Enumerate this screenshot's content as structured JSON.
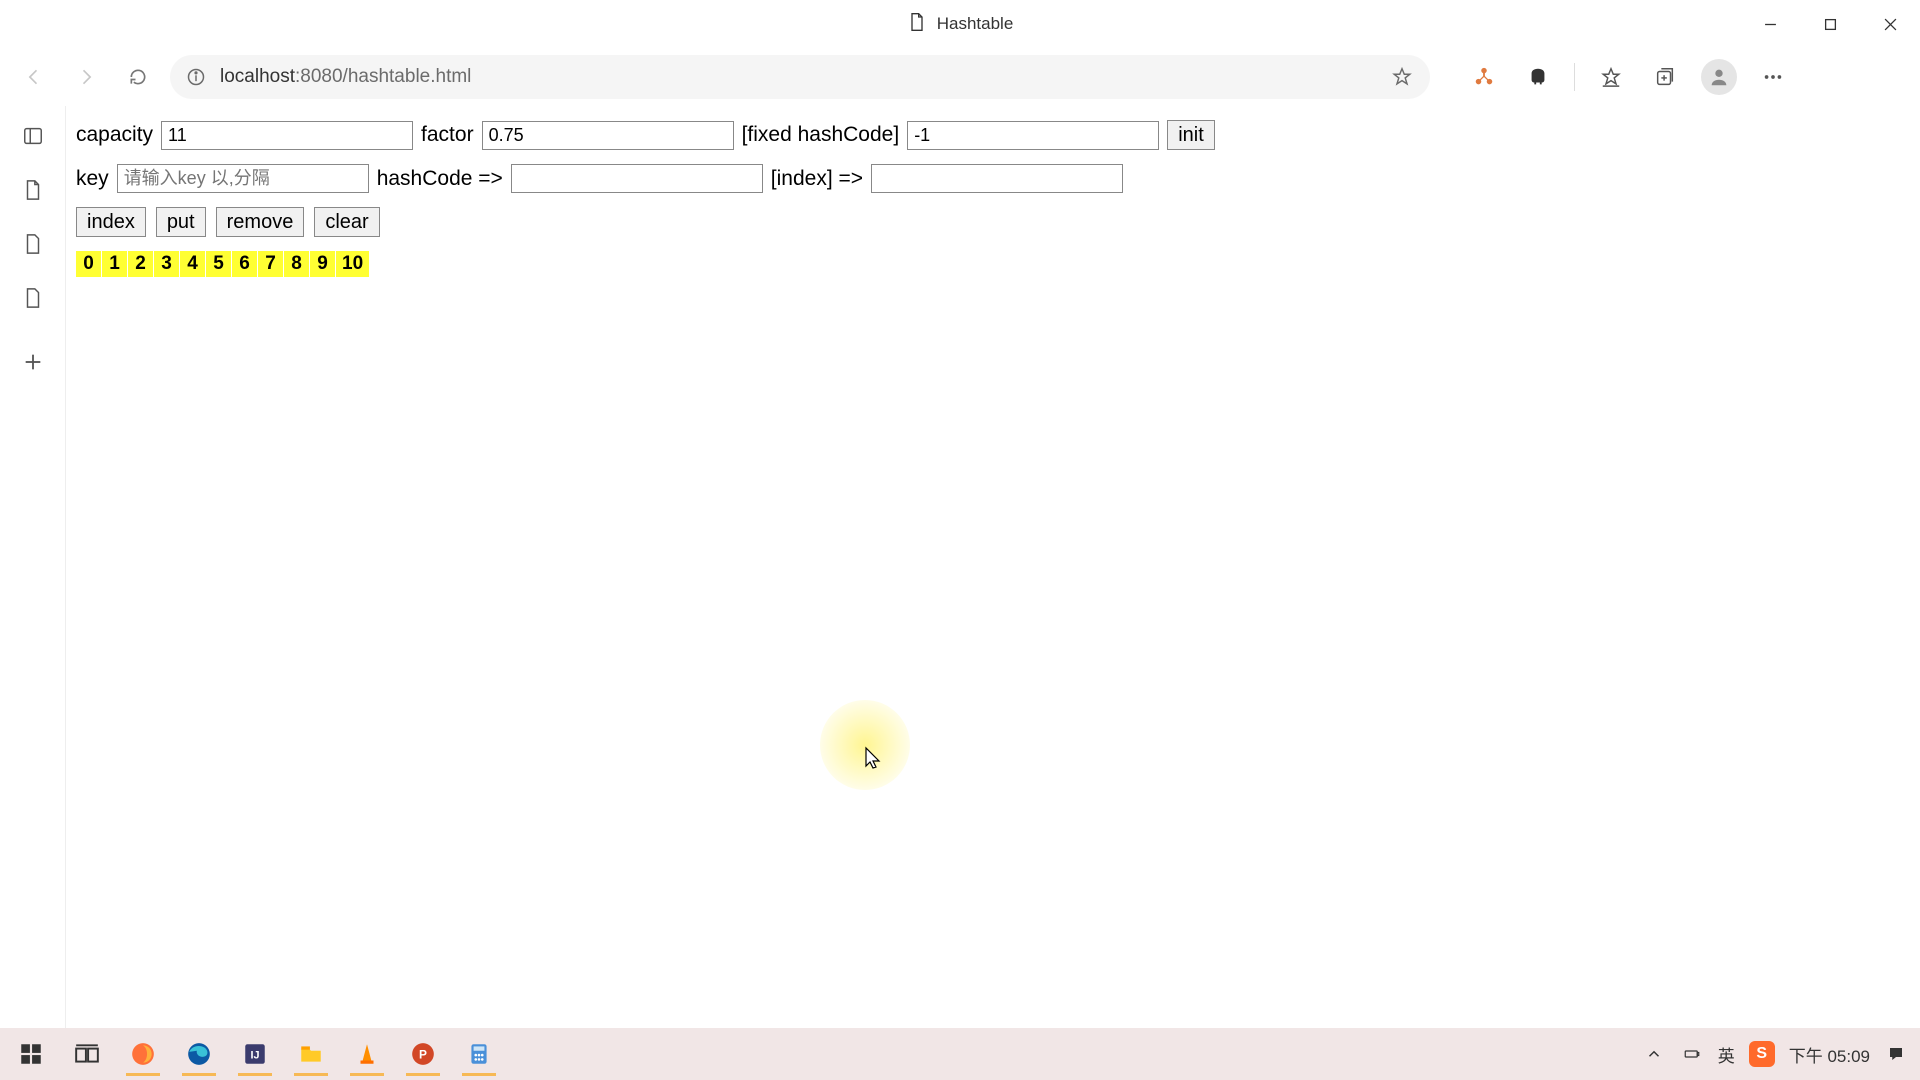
{
  "window": {
    "title": "Hashtable"
  },
  "address": {
    "host": "localhost",
    "port": ":8080",
    "path": "/hashtable.html"
  },
  "form": {
    "capacity_label": "capacity",
    "capacity_value": "11",
    "factor_label": "factor",
    "factor_value": "0.75",
    "fixed_label": "[fixed hashCode]",
    "fixed_value": "-1",
    "init_label": "init",
    "key_label": "key",
    "key_placeholder": "请输入key 以,分隔",
    "key_value": "",
    "hashcode_label": "hashCode =>",
    "hashcode_value": "",
    "index_label": "[index] =>",
    "index_value": ""
  },
  "buttons": {
    "index": "index",
    "put": "put",
    "remove": "remove",
    "clear": "clear"
  },
  "buckets": [
    "0",
    "1",
    "2",
    "3",
    "4",
    "5",
    "6",
    "7",
    "8",
    "9",
    "10"
  ],
  "tray": {
    "ime": "英",
    "time": "下午 05:09"
  }
}
